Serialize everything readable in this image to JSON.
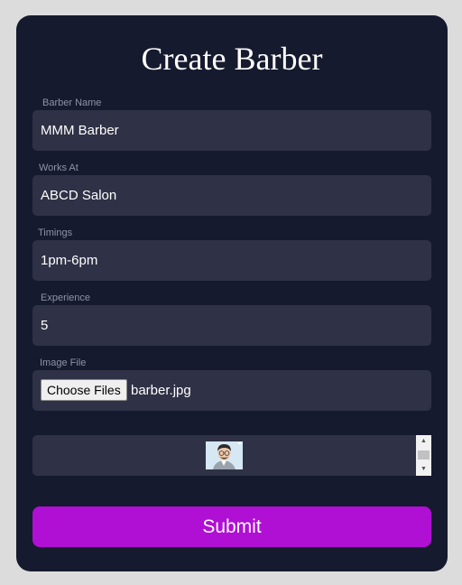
{
  "form": {
    "title": "Create Barber",
    "fields": [
      {
        "label": "Barber Name",
        "value": "MMM Barber"
      },
      {
        "label": "Works At",
        "value": "ABCD Salon"
      },
      {
        "label": "Timings",
        "value": "1pm-6pm"
      },
      {
        "label": "Experience",
        "value": "5"
      }
    ],
    "image_file": {
      "label": "Image File",
      "button_label": "Choose Files",
      "file_name": "barber.jpg"
    },
    "submit_label": "Submit"
  },
  "colors": {
    "page_background": "#dcdcdc",
    "card_background": "#161a2e",
    "field_background": "#2f3246",
    "label_text": "#8f93a8",
    "submit_background": "#b00fd4"
  }
}
